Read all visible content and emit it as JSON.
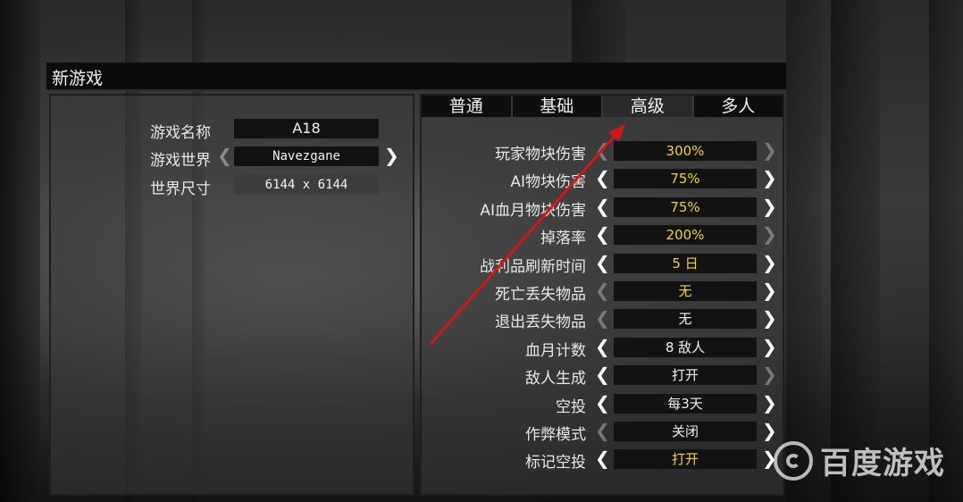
{
  "window": {
    "title": "新游戏"
  },
  "left": {
    "rows": [
      {
        "label": "游戏名称",
        "value": "A18"
      },
      {
        "label": "游戏世界",
        "value": "Navezgane"
      },
      {
        "label": "世界尺寸",
        "value": "6144 x 6144"
      }
    ]
  },
  "tabs": [
    {
      "label": "普通"
    },
    {
      "label": "基础"
    },
    {
      "label": "高级",
      "active": true
    },
    {
      "label": "多人"
    }
  ],
  "settings": [
    {
      "label": "玩家物块伤害",
      "value": "300%",
      "highlight": true
    },
    {
      "label": "AI物块伤害",
      "value": "75%",
      "highlight": true
    },
    {
      "label": "AI血月物块伤害",
      "value": "75%",
      "highlight": true
    },
    {
      "label": "掉落率",
      "value": "200%",
      "highlight": true
    },
    {
      "label": "战利品刷新时间",
      "value": "5 日",
      "highlight": true
    },
    {
      "label": "死亡丢失物品",
      "value": "无",
      "highlight": true
    },
    {
      "label": "退出丢失物品",
      "value": "无",
      "highlight": false
    },
    {
      "label": "血月计数",
      "value": "8 敌人",
      "highlight": false
    },
    {
      "label": "敌人生成",
      "value": "打开",
      "highlight": false
    },
    {
      "label": "空投",
      "value": "每3天",
      "highlight": false
    },
    {
      "label": "作弊模式",
      "value": "关闭",
      "highlight": false
    },
    {
      "label": "标记空投",
      "value": "打开",
      "highlight": true
    }
  ],
  "watermark": {
    "text": "百度游戏"
  },
  "colors": {
    "highlight": "#f2d23c",
    "annotation": "#d01818"
  }
}
